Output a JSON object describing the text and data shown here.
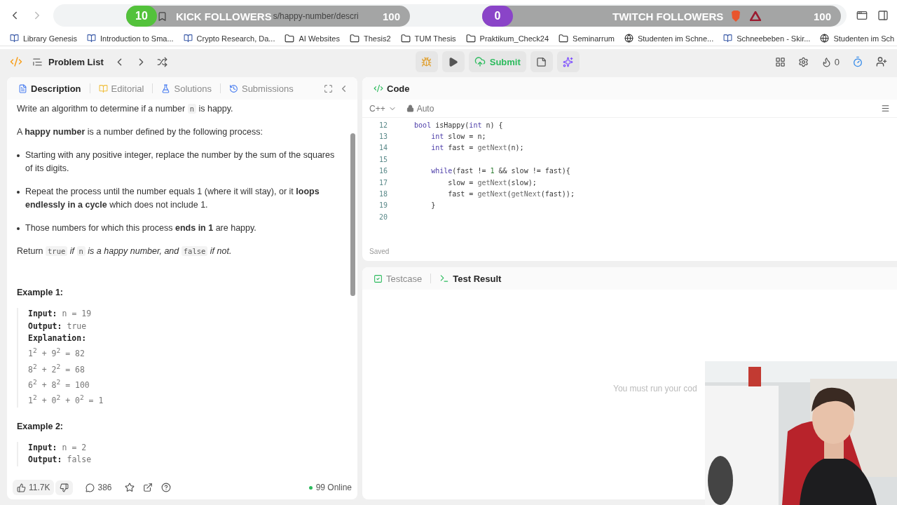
{
  "browser": {
    "url_fragment": "s/happy-number/descri",
    "bookmarks": [
      {
        "label": "Library Genesis",
        "kind": "site"
      },
      {
        "label": "Introduction to Sma...",
        "kind": "site"
      },
      {
        "label": "Crypto Research, Da...",
        "kind": "site"
      },
      {
        "label": "AI Websites",
        "kind": "folder"
      },
      {
        "label": "Thesis2",
        "kind": "folder"
      },
      {
        "label": "TUM Thesis",
        "kind": "folder"
      },
      {
        "label": "Praktikum_Check24",
        "kind": "folder"
      },
      {
        "label": "Seminarrum",
        "kind": "folder"
      },
      {
        "label": "Studenten im Schne...",
        "kind": "globe"
      },
      {
        "label": "Schneebeben - Skir...",
        "kind": "site"
      },
      {
        "label": "Studenten im Sch",
        "kind": "globe"
      }
    ]
  },
  "overlays": [
    {
      "kind": "kick",
      "count": "10",
      "label": "KICK FOLLOWERS",
      "goal": "100",
      "color": "#53c23b"
    },
    {
      "kind": "twitch",
      "count": "0",
      "label": "TWITCH FOLLOWERS",
      "goal": "100",
      "color": "#8a44c8"
    }
  ],
  "toolbar": {
    "problem_list": "Problem List",
    "submit": "Submit",
    "streak": "0"
  },
  "description": {
    "tabs": [
      {
        "label": "Description",
        "selected": true
      },
      {
        "label": "Editorial",
        "selected": false
      },
      {
        "label": "Solutions",
        "selected": false
      },
      {
        "label": "Submissions",
        "selected": false
      }
    ],
    "paragraphs": [
      {
        "kind": "para",
        "segments": [
          {
            "kind": "text",
            "t": "Write an algorithm to determine if a number "
          },
          {
            "kind": "code",
            "t": "n"
          },
          {
            "kind": "text",
            "t": " is happy."
          }
        ]
      },
      {
        "kind": "para",
        "segments": [
          {
            "kind": "text",
            "t": "A **happy number** is a number defined by the following process:"
          }
        ]
      },
      {
        "kind": "bullet",
        "segments": [
          {
            "kind": "text",
            "t": "Starting with any positive integer, replace the number by the sum of the squares of its digits."
          }
        ]
      },
      {
        "kind": "bullet",
        "segments": [
          {
            "kind": "text",
            "t": "Repeat the process until the number equals 1 (where it will stay), or it **loops endlessly in a cycle** which does not include 1."
          }
        ]
      },
      {
        "kind": "bullet",
        "segments": [
          {
            "kind": "text",
            "t": "Those numbers for which this process **ends in 1** are happy."
          }
        ]
      },
      {
        "kind": "para",
        "segments": [
          {
            "kind": "text",
            "t": "Return "
          },
          {
            "kind": "code",
            "t": "true"
          },
          {
            "kind": "italic",
            "t": " if "
          },
          {
            "kind": "code",
            "t": "n"
          },
          {
            "kind": "italic",
            "t": " is a happy number, and "
          },
          {
            "kind": "code",
            "t": "false"
          },
          {
            "kind": "italic",
            "t": " if not."
          }
        ]
      }
    ],
    "examples": [
      {
        "title": "Example 1:",
        "lines": [
          {
            "label": "Input:",
            "value": "n = 19"
          },
          {
            "label": "Output:",
            "value": "true"
          },
          {
            "label": "Explanation:"
          },
          {
            "value": "1$^{2}$ + 9$^{2}$ = 82"
          },
          {
            "value": "8$^{2}$ + 2$^{2}$ = 68"
          },
          {
            "value": "6$^{2}$ + 8$^{2}$ = 100"
          },
          {
            "value": "1$^{2}$ + 0$^{2}$ + 0$^{2}$ = 1"
          }
        ]
      },
      {
        "title": "Example 2:",
        "lines": [
          {
            "label": "Input:",
            "value": "n = 2"
          },
          {
            "label": "Output:",
            "value": "false"
          }
        ]
      }
    ],
    "footer": {
      "likes": "11.7K",
      "comments": "386",
      "online": "99 Online"
    }
  },
  "code": {
    "title": "Code",
    "language": "C++",
    "mode": "Auto",
    "status": "Saved",
    "lines": [
      {
        "num": "12",
        "tokens": [
          {
            "kind": "kw",
            "t": "    bool"
          },
          {
            "kind": "plain",
            "t": " isHappy("
          },
          {
            "kind": "kw",
            "t": "int"
          },
          {
            "kind": "plain",
            "t": " n) {"
          }
        ]
      },
      {
        "num": "13",
        "tokens": [
          {
            "kind": "kw",
            "t": "        int"
          },
          {
            "kind": "plain",
            "t": " slow = n;"
          }
        ]
      },
      {
        "num": "14",
        "tokens": [
          {
            "kind": "kw",
            "t": "        int"
          },
          {
            "kind": "plain",
            "t": " fast = "
          },
          {
            "kind": "fn",
            "t": "getNext"
          },
          {
            "kind": "plain",
            "t": "(n);"
          }
        ]
      },
      {
        "num": "15"
      },
      {
        "num": "16",
        "tokens": [
          {
            "kind": "kw",
            "t": "        while"
          },
          {
            "kind": "plain",
            "t": "(fast != "
          },
          {
            "kind": "num",
            "t": "1"
          },
          {
            "kind": "plain",
            "t": " && slow != fast){"
          }
        ]
      },
      {
        "num": "17",
        "tokens": [
          {
            "kind": "plain",
            "t": "            slow = "
          },
          {
            "kind": "fn",
            "t": "getNext"
          },
          {
            "kind": "plain",
            "t": "(slow);"
          }
        ]
      },
      {
        "num": "18",
        "tokens": [
          {
            "kind": "plain",
            "t": "            fast = "
          },
          {
            "kind": "fn",
            "t": "getNext"
          },
          {
            "kind": "plain",
            "t": "("
          },
          {
            "kind": "fn",
            "t": "getNext"
          },
          {
            "kind": "plain",
            "t": "(fast));"
          }
        ]
      },
      {
        "num": "19",
        "tokens": [
          {
            "kind": "plain",
            "t": "        }"
          }
        ]
      },
      {
        "num": "20"
      }
    ]
  },
  "results": {
    "tabs": [
      {
        "label": "Testcase",
        "selected": false
      },
      {
        "label": "Test Result",
        "selected": true
      }
    ],
    "message": "You must run your cod"
  }
}
